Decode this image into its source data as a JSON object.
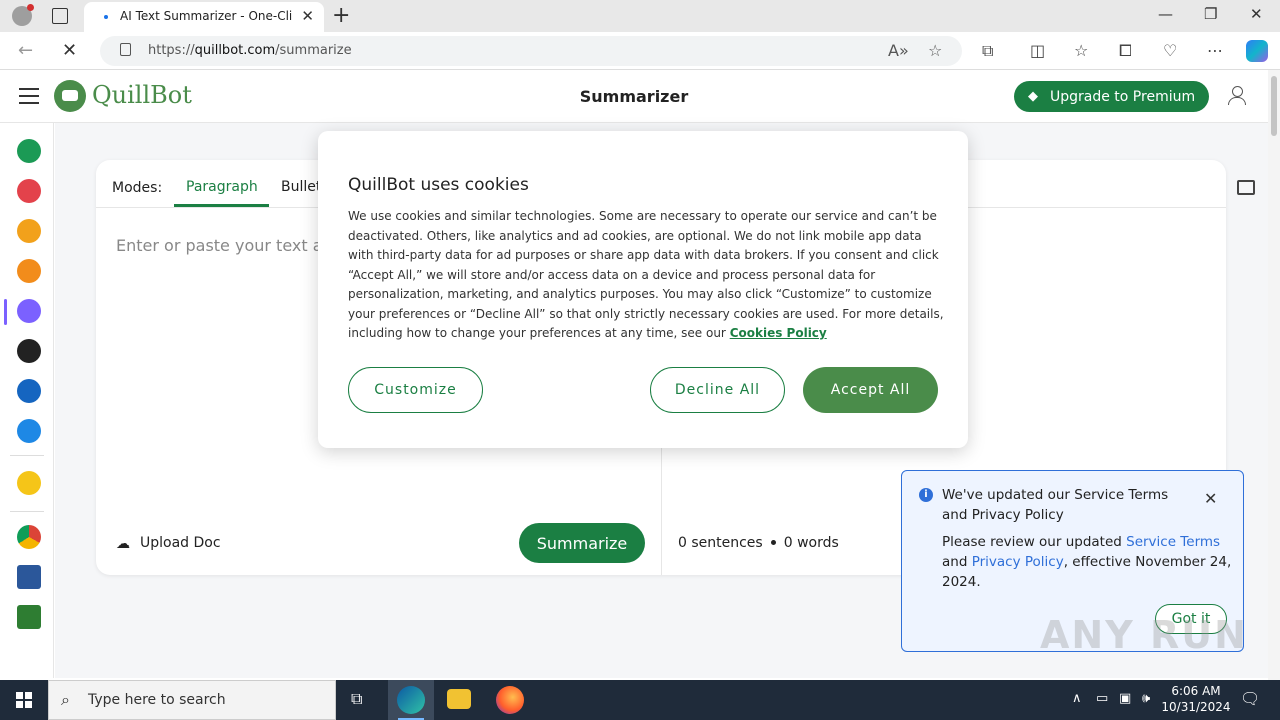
{
  "browser": {
    "tab_title": "AI Text Summarizer - One-Click S",
    "url_prefix": "https://",
    "url_host": "quillbot.com",
    "url_path": "/summarize"
  },
  "header": {
    "logo_text": "QuillBot",
    "page_title": "Summarizer",
    "premium_label": "Upgrade to Premium"
  },
  "editor": {
    "modes_label": "Modes:",
    "modes": [
      "Paragraph",
      "Bullet"
    ],
    "placeholder": "Enter or paste your text an",
    "upload_label": "Upload Doc",
    "summarize_label": "Summarize",
    "sentences": "0 sentences",
    "words": "0 words"
  },
  "cookie": {
    "title": "QuillBot uses cookies",
    "body": "We use cookies and similar technologies. Some are necessary to operate our service and can’t be deactivated. Others, like analytics and ad cookies, are optional. We do not link mobile app data with third-party data for ad purposes or share app data with data brokers. If you consent and click “Accept All,” we will store and/or access data on a device and process personal data for personalization, marketing, and analytics purposes. You may also click “Customize” to customize your preferences or “Decline All” so that only strictly necessary cookies are used. For more details, including how to change your preferences at any time, see our",
    "link": "Cookies Policy",
    "customize": "Customize",
    "decline": "Decline All",
    "accept": "Accept All"
  },
  "toast": {
    "title": "We've updated our Service Terms and Privacy Policy",
    "body_1": "Please review our updated ",
    "link_terms": "Service Terms",
    "body_2": " and ",
    "link_privacy": "Privacy Policy",
    "body_3": ", effective November 24, 2024.",
    "got_it": "Got it"
  },
  "watermark": "ANY RUN",
  "taskbar": {
    "search_placeholder": "Type here to search",
    "time": "6:06 AM",
    "date": "10/31/2024"
  },
  "colors": {
    "brand_green": "#1b7f43",
    "logo_green": "#4a8c4a",
    "toast_blue": "#2f6fd8"
  }
}
